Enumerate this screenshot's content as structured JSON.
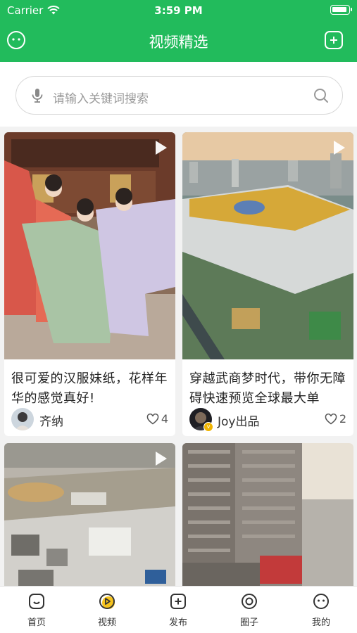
{
  "status_bar": {
    "carrier": "Carrier",
    "time": "3:59 PM"
  },
  "nav": {
    "title": "视频精选",
    "left_icon": "smile-face-icon",
    "right_icon": "add-square-icon"
  },
  "search": {
    "placeholder": "请输入关键词搜索",
    "left_icon": "microphone-icon",
    "right_icon": "search-icon"
  },
  "cards": [
    {
      "title": "很可爱的汉服妹纸，花样年华的感觉真好!",
      "author": "齐纳",
      "likes": "4",
      "image": "hanfu-girls-photo"
    },
    {
      "title": "穿越武商梦时代，带你无障碍快速预览全球最大单",
      "author": "Joy出品",
      "likes": "2",
      "image": "mall-aerial-photo",
      "verified": true
    },
    {
      "title": "",
      "author": "",
      "likes": "",
      "image": "construction-site-aerial-photo"
    },
    {
      "title": "",
      "author": "",
      "likes": "",
      "image": "highrise-building-photo"
    }
  ],
  "tabs": [
    {
      "label": "首页",
      "icon": "home-icon"
    },
    {
      "label": "视频",
      "icon": "video-play-icon",
      "active": true
    },
    {
      "label": "发布",
      "icon": "publish-icon"
    },
    {
      "label": "圈子",
      "icon": "circle-icon"
    },
    {
      "label": "我的",
      "icon": "profile-icon"
    }
  ],
  "colors": {
    "brand": "#22bb5c",
    "active_tab_accent": "#f6c31c"
  }
}
